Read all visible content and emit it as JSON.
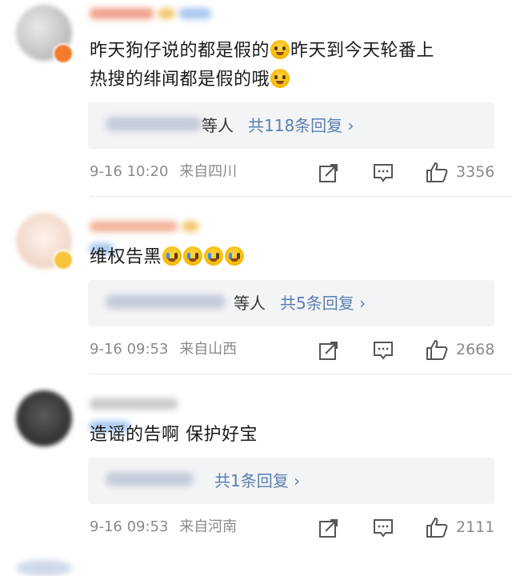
{
  "comments": [
    {
      "text_a": "昨天狗仔说的都是假的",
      "text_b": "昨天到今天轮番上",
      "text_c": "热搜的绯闻都是假的哦",
      "reply_suffix": "等人",
      "reply_count": "共118条回复 ›",
      "time": "9-16 10:20",
      "location": "来自四川",
      "likes": "3356"
    },
    {
      "text_a": "维权告黑",
      "reply_suffix": "等人",
      "reply_count": "共5条回复 ›",
      "time": "9-16 09:53",
      "location": "来自山西",
      "likes": "2668"
    },
    {
      "text_a": "造谣的告啊 保护好宝",
      "reply_count": "共1条回复 ›",
      "time": "9-16 09:53",
      "location": "来自河南",
      "likes": "2111"
    }
  ],
  "icons": {
    "share": "share-icon",
    "comment": "comment-icon",
    "like": "thumbs-up-icon",
    "emoji": "emoji-icon"
  }
}
